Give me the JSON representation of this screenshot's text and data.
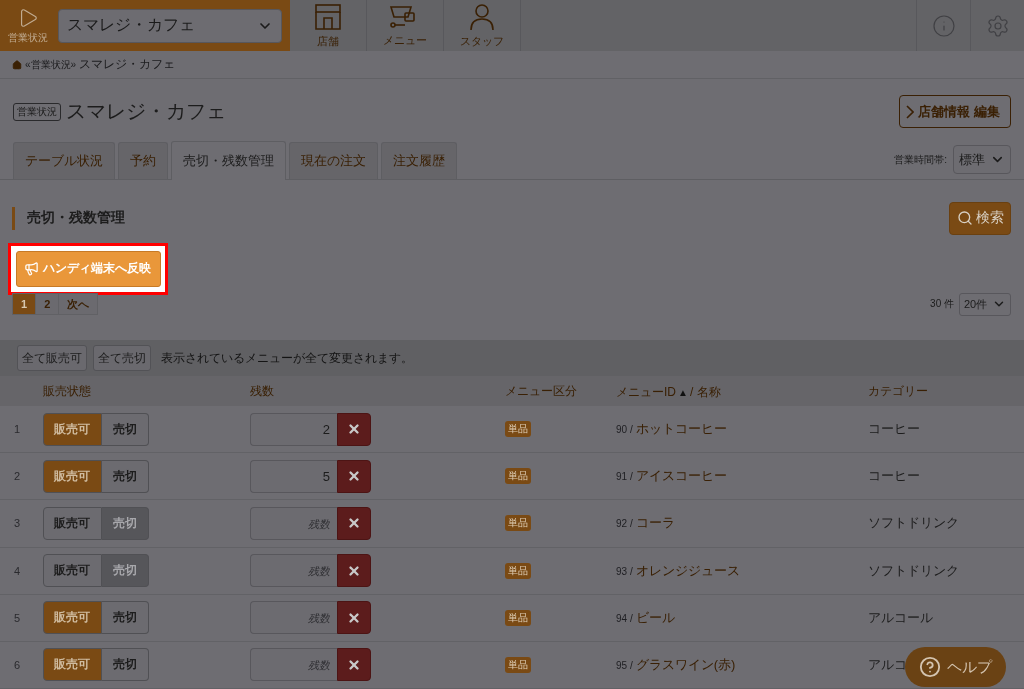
{
  "header": {
    "status_label": "営業状況",
    "store_select": "スマレジ・カフェ",
    "nav": [
      {
        "label": "店舗"
      },
      {
        "label": "メニュー"
      },
      {
        "label": "スタッフ"
      }
    ]
  },
  "breadcrumb": [
    "«営業状況»",
    "スマレジ・カフェ"
  ],
  "page": {
    "badge": "営業状況",
    "title": "スマレジ・カフェ",
    "edit_button": "店舗情報 編集"
  },
  "tabs": [
    {
      "label": "テーブル状況",
      "selected": false
    },
    {
      "label": "予約",
      "selected": false
    },
    {
      "label": "売切・残数管理",
      "selected": true
    },
    {
      "label": "現在の注文",
      "selected": false
    },
    {
      "label": "注文履歴",
      "selected": false
    }
  ],
  "time_band": {
    "label": "営業時間帯:",
    "value": "標準"
  },
  "section": {
    "title": "売切・残数管理",
    "search_button": "検索",
    "sync_button": "ハンディ端末へ反映"
  },
  "pagination": [
    {
      "label": "1",
      "selected": true
    },
    {
      "label": "2",
      "selected": false
    },
    {
      "label": "次へ",
      "selected": false
    }
  ],
  "count": "30 件",
  "per_page": "20件",
  "bulk": {
    "buttons": [
      "全て販売可",
      "全て売切"
    ],
    "note": "表示されているメニューが全て変更されます。"
  },
  "columns": {
    "status": "販売状態",
    "remaining": "残数",
    "type": "メニュー区分",
    "id": "メニューID",
    "sort": "▲",
    "name": "/ 名称",
    "category": "カテゴリー"
  },
  "rows": [
    {
      "no": "1",
      "toggle": [
        {
          "label": "販売可",
          "selected": true
        },
        {
          "label": "売切",
          "selected": false
        }
      ],
      "value": "2",
      "type": "単品",
      "id": "90 /",
      "name": "ホットコーヒー",
      "category": "コーヒー"
    },
    {
      "no": "2",
      "toggle": [
        {
          "label": "販売可",
          "selected": true
        },
        {
          "label": "売切",
          "selected": false
        }
      ],
      "value": "5",
      "type": "単品",
      "id": "91 /",
      "name": "アイスコーヒー",
      "category": "コーヒー"
    },
    {
      "no": "3",
      "toggle": [
        {
          "label": "販売可",
          "selected": false
        },
        {
          "label": "売切",
          "selected": true
        }
      ],
      "placeholder": "残数",
      "type": "単品",
      "id": "92 /",
      "name": "コーラ",
      "category": "ソフトドリンク"
    },
    {
      "no": "4",
      "toggle": [
        {
          "label": "販売可",
          "selected": false
        },
        {
          "label": "売切",
          "selected": true
        }
      ],
      "placeholder": "残数",
      "type": "単品",
      "id": "93 /",
      "name": "オレンジジュース",
      "category": "ソフトドリンク"
    },
    {
      "no": "5",
      "toggle": [
        {
          "label": "販売可",
          "selected": true
        },
        {
          "label": "売切",
          "selected": false
        }
      ],
      "placeholder": "残数",
      "type": "単品",
      "id": "94 /",
      "name": "ビール",
      "category": "アルコール"
    },
    {
      "no": "6",
      "toggle": [
        {
          "label": "販売可",
          "selected": true
        },
        {
          "label": "売切",
          "selected": false
        }
      ],
      "placeholder": "残数",
      "type": "単品",
      "id": "95 /",
      "name": "グラスワイン(赤)",
      "category": "アルコ"
    }
  ],
  "help_button": "ヘルプ"
}
